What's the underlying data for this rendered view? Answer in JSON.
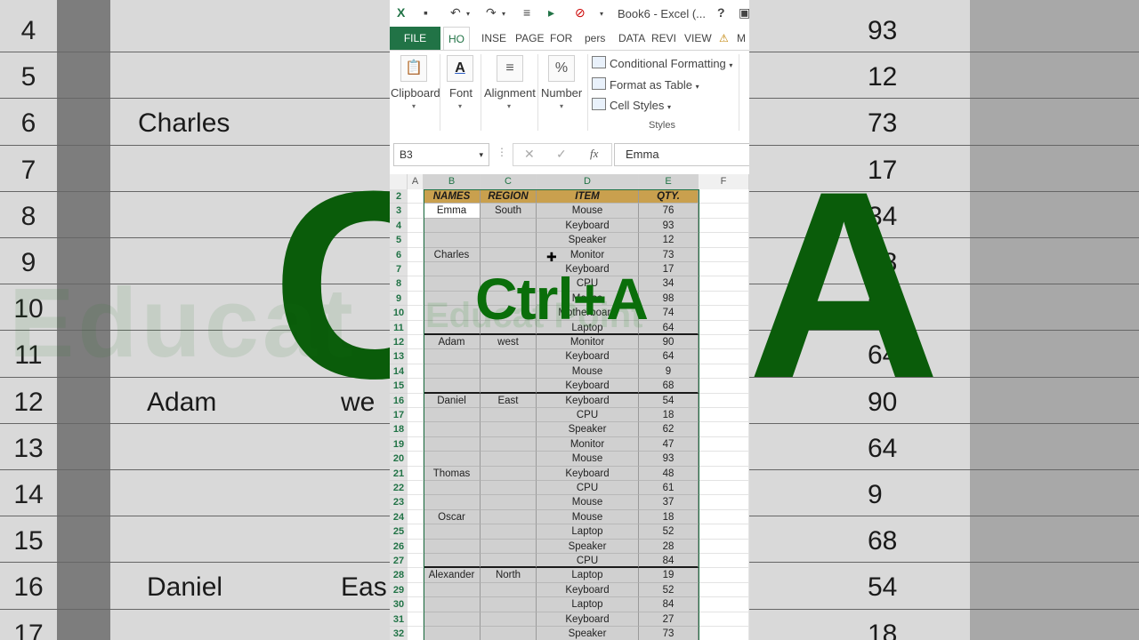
{
  "background": {
    "row_numbers": [
      "4",
      "5",
      "6",
      "7",
      "8",
      "9",
      "10",
      "11",
      "12",
      "13",
      "14",
      "15",
      "16",
      "17"
    ],
    "names": [
      {
        "row": "6",
        "text": "Charles"
      },
      {
        "row": "12",
        "text": "Adam"
      },
      {
        "row": "16",
        "text": "Daniel"
      }
    ],
    "regions": [
      {
        "row": "12",
        "text": "we"
      },
      {
        "row": "16",
        "text": "Eas"
      }
    ],
    "qty": [
      "93",
      "12",
      "73",
      "17",
      "34",
      "98",
      "74",
      "64",
      "90",
      "64",
      "9",
      "68",
      "54",
      "18"
    ],
    "big_left": "C",
    "big_right": "A",
    "watermark": "Educat Point"
  },
  "qat": {
    "title": "Book6 - Excel (..."
  },
  "ribbon": {
    "tabs": [
      "FILE",
      "HO",
      "INSE",
      "PAGE",
      "FOR",
      "pers",
      "DATA",
      "REVI",
      "VIEW",
      "M"
    ],
    "groups": {
      "clipboard": "Clipboard",
      "font": "Font",
      "alignment": "Alignment",
      "number": "Number"
    },
    "styles": {
      "conditional": "Conditional Formatting",
      "format_table": "Format as Table",
      "cell_styles": "Cell Styles",
      "label": "Styles"
    }
  },
  "formula_bar": {
    "name_box": "B3",
    "value": "Emma"
  },
  "grid": {
    "columns": [
      "A",
      "B",
      "C",
      "D",
      "E",
      "F"
    ],
    "header": {
      "row": "2",
      "names": "NAMES",
      "region": "REGION",
      "item": "ITEM",
      "qty": "QTY."
    },
    "rows": [
      {
        "r": "3",
        "name": "Emma",
        "region": "South",
        "item": "Mouse",
        "qty": "76"
      },
      {
        "r": "4",
        "name": "",
        "region": "",
        "item": "Keyboard",
        "qty": "93"
      },
      {
        "r": "5",
        "name": "",
        "region": "",
        "item": "Speaker",
        "qty": "12"
      },
      {
        "r": "6",
        "name": "Charles",
        "region": "",
        "item": "Monitor",
        "qty": "73"
      },
      {
        "r": "7",
        "name": "",
        "region": "",
        "item": "Keyboard",
        "qty": "17"
      },
      {
        "r": "8",
        "name": "",
        "region": "",
        "item": "CPU",
        "qty": "34"
      },
      {
        "r": "9",
        "name": "",
        "region": "",
        "item": "Mouse",
        "qty": "98"
      },
      {
        "r": "10",
        "name": "",
        "region": "",
        "item": "Motherboard",
        "qty": "74"
      },
      {
        "r": "11",
        "name": "",
        "region": "",
        "item": "Laptop",
        "qty": "64"
      },
      {
        "r": "12",
        "name": "Adam",
        "region": "west",
        "item": "Monitor",
        "qty": "90"
      },
      {
        "r": "13",
        "name": "",
        "region": "",
        "item": "Keyboard",
        "qty": "64"
      },
      {
        "r": "14",
        "name": "",
        "region": "",
        "item": "Mouse",
        "qty": "9"
      },
      {
        "r": "15",
        "name": "",
        "region": "",
        "item": "Keyboard",
        "qty": "68"
      },
      {
        "r": "16",
        "name": "Daniel",
        "region": "East",
        "item": "Keyboard",
        "qty": "54"
      },
      {
        "r": "17",
        "name": "",
        "region": "",
        "item": "CPU",
        "qty": "18"
      },
      {
        "r": "18",
        "name": "",
        "region": "",
        "item": "Speaker",
        "qty": "62"
      },
      {
        "r": "19",
        "name": "",
        "region": "",
        "item": "Monitor",
        "qty": "47"
      },
      {
        "r": "20",
        "name": "",
        "region": "",
        "item": "Mouse",
        "qty": "93"
      },
      {
        "r": "21",
        "name": "Thomas",
        "region": "",
        "item": "Keyboard",
        "qty": "48"
      },
      {
        "r": "22",
        "name": "",
        "region": "",
        "item": "CPU",
        "qty": "61"
      },
      {
        "r": "23",
        "name": "",
        "region": "",
        "item": "Mouse",
        "qty": "37"
      },
      {
        "r": "24",
        "name": "Oscar",
        "region": "",
        "item": "Mouse",
        "qty": "18"
      },
      {
        "r": "25",
        "name": "",
        "region": "",
        "item": "Laptop",
        "qty": "52"
      },
      {
        "r": "26",
        "name": "",
        "region": "",
        "item": "Speaker",
        "qty": "28"
      },
      {
        "r": "27",
        "name": "",
        "region": "",
        "item": "CPU",
        "qty": "84"
      },
      {
        "r": "28",
        "name": "Alexander",
        "region": "North",
        "item": "Laptop",
        "qty": "19"
      },
      {
        "r": "29",
        "name": "",
        "region": "",
        "item": "Keyboard",
        "qty": "52"
      },
      {
        "r": "30",
        "name": "",
        "region": "",
        "item": "Laptop",
        "qty": "84"
      },
      {
        "r": "31",
        "name": "",
        "region": "",
        "item": "Keyboard",
        "qty": "27"
      },
      {
        "r": "32",
        "name": "",
        "region": "",
        "item": "Speaker",
        "qty": "73"
      }
    ]
  },
  "overlay": {
    "shortcut": "Ctrl+A",
    "watermark": "Educat Point"
  },
  "colors": {
    "excel_green": "#217346",
    "header_fill": "#c9a04e",
    "overlay_text": "#0a6e0a"
  }
}
